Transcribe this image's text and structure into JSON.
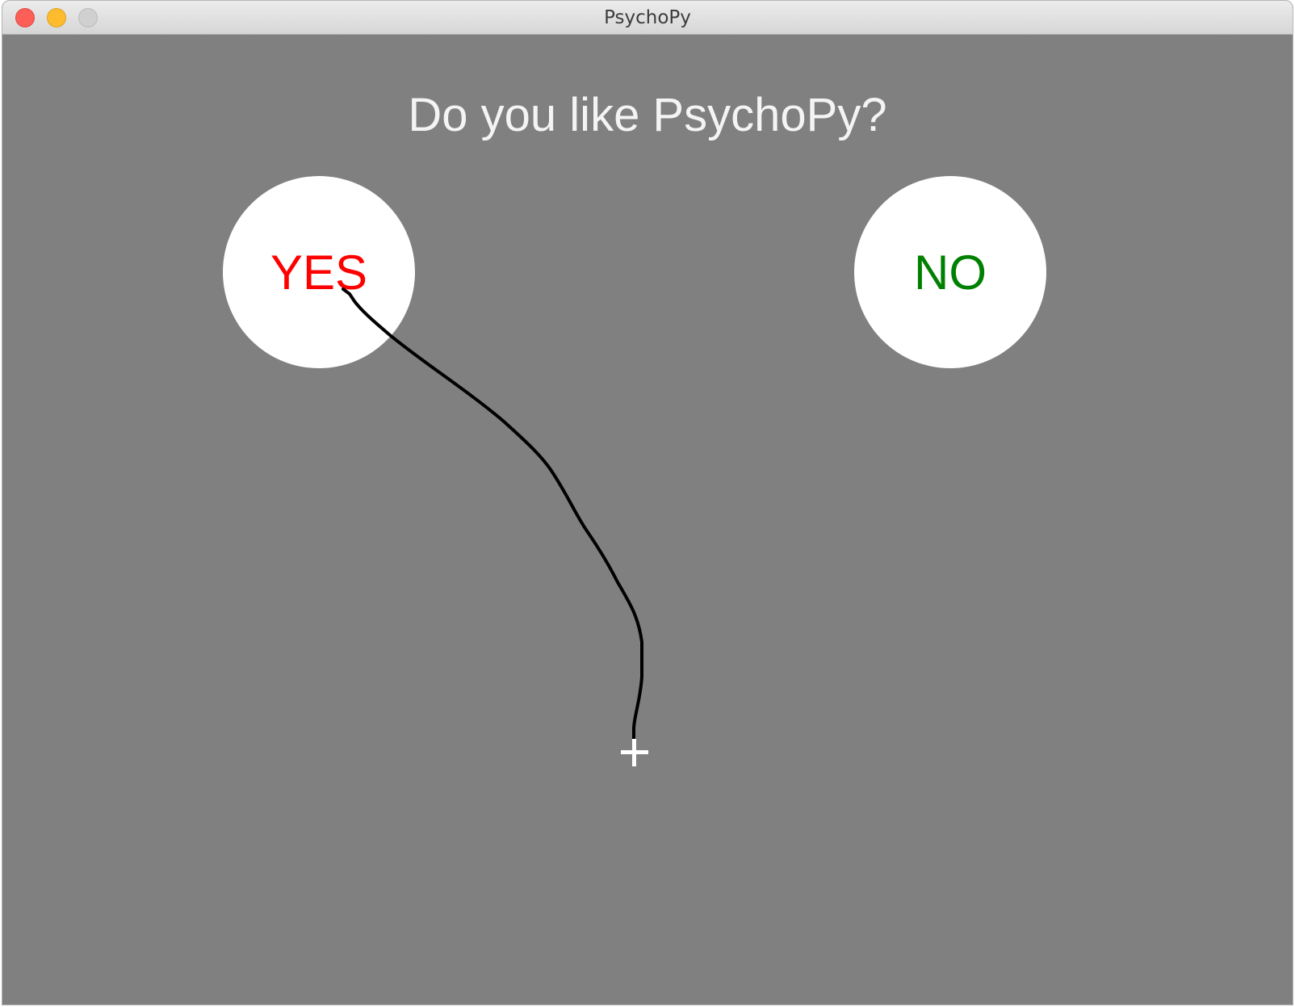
{
  "window": {
    "title": "PsychoPy"
  },
  "colors": {
    "background": "#808080",
    "question_text": "#f4f4f4",
    "option_circle": "#ffffff",
    "yes_text": "#ff0000",
    "no_text": "#008000",
    "trajectory": "#000000"
  },
  "stimulus": {
    "question": "Do you like PsychoPy?",
    "options": [
      {
        "label": "YES",
        "color": "#ff0000"
      },
      {
        "label": "NO",
        "color": "#008000"
      }
    ]
  },
  "icons": {
    "window_buttons": [
      "close-icon",
      "minimize-icon",
      "maximize-icon"
    ],
    "fixation": "plus-icon"
  }
}
